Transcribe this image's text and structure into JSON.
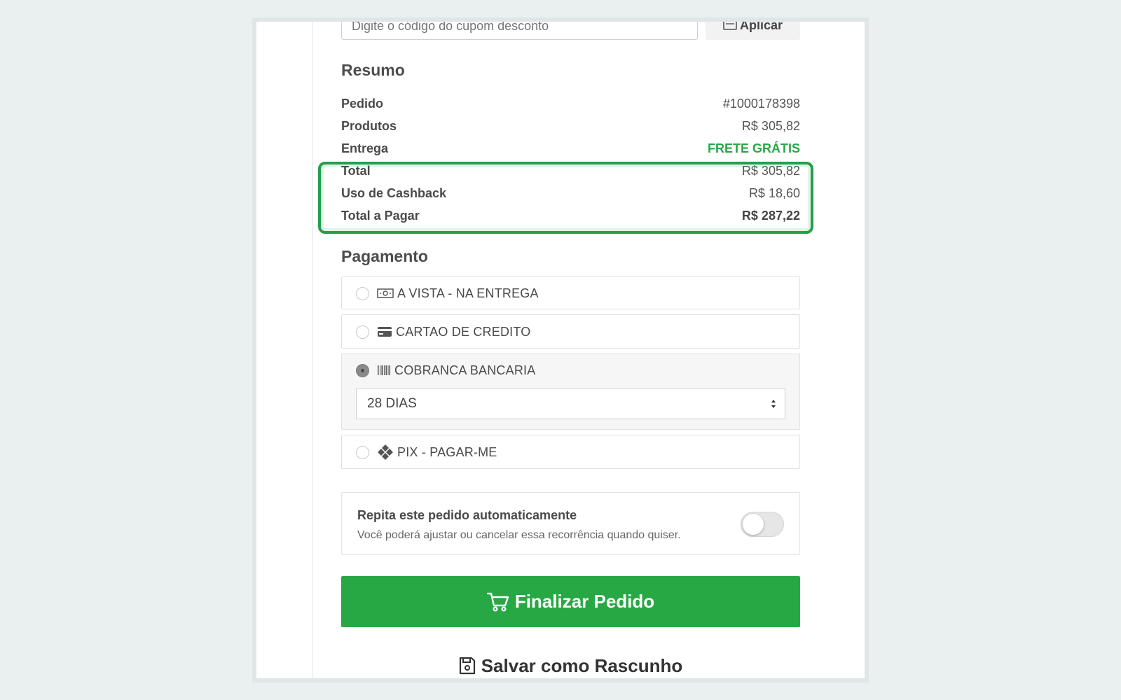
{
  "coupon": {
    "placeholder": "Digite o código do cupom desconto",
    "apply_label": "Aplicar"
  },
  "summary": {
    "title": "Resumo",
    "rows": [
      {
        "label": "Pedido",
        "value": "#1000178398"
      },
      {
        "label": "Produtos",
        "value": "R$ 305,82"
      },
      {
        "label": "Entrega",
        "value": "FRETE GRÁTIS"
      },
      {
        "label": "Total",
        "value": "R$ 305,82"
      },
      {
        "label": "Uso de Cashback",
        "value": "R$ 18,60"
      },
      {
        "label": "Total a Pagar",
        "value": "R$ 287,22"
      }
    ],
    "highlight_color": "#22a04b",
    "free_shipping_color": "#28a745"
  },
  "payment": {
    "title": "Pagamento",
    "options": [
      {
        "label": "A VISTA - NA ENTREGA",
        "icon": "cash-icon",
        "selected": false
      },
      {
        "label": "CARTAO DE CREDITO",
        "icon": "credit-card-icon",
        "selected": false
      },
      {
        "label": "COBRANCA BANCARIA",
        "icon": "barcode-icon",
        "selected": true
      },
      {
        "label": "PIX - PAGAR-ME",
        "icon": "pix-icon",
        "selected": false
      }
    ],
    "installment_selected": "28 DIAS"
  },
  "recurrence": {
    "title": "Repita este pedido automaticamente",
    "subtitle": "Você poderá ajustar ou cancelar essa recorrência quando quiser.",
    "enabled": false
  },
  "actions": {
    "finalize_label": "Finalizar Pedido",
    "draft_label": "Salvar como Rascunho",
    "primary_color": "#28a745"
  }
}
